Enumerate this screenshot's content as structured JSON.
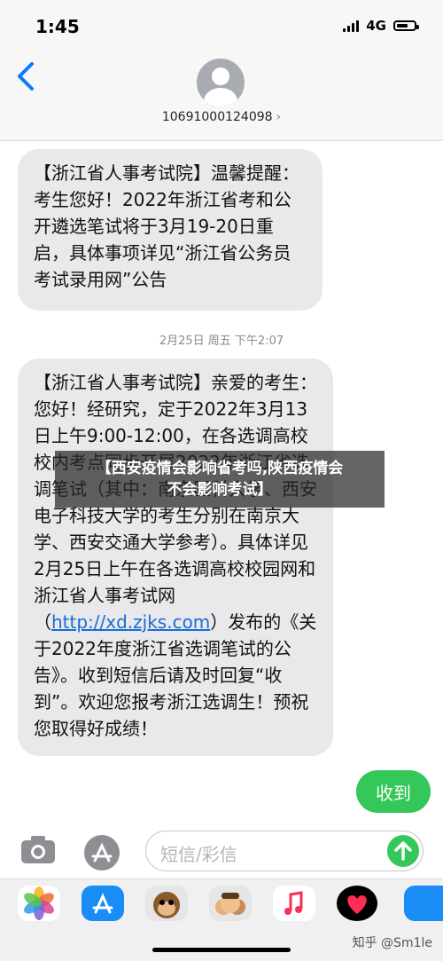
{
  "status_bar": {
    "time": "1:45",
    "network": "4G"
  },
  "header": {
    "sender": "10691000124098",
    "chevron": "›"
  },
  "messages": {
    "msg1": "【浙江省人事考试院】温馨提醒：考生您好！2022年浙江省考和公开遴选笔试将于3月19-20日重启，具体事项详见“浙江省公务员考试录用网”公告",
    "timestamp": "2月25日 周五 下午2:07",
    "msg2_part1": "【浙江省人事考试院】亲爱的考生：您好！经研究，定于2022年3月13日上午9:00-12:00，在各选调高校校内考点同步开展2022年浙江省选调笔试（其中：南京医科大学、西安电子科技大学的考生分别在南京大学、西安交通大学参考）。具体详见2月25日上午在各选调高校校园网和浙江省人事考试网（",
    "msg2_link": "http://xd.zjks.com",
    "msg2_part2": "）发布的《关于2022年度浙江省选调笔试的公告》。收到短信后请及时回复“收到”。欢迎您报考浙江选调生！预祝您取得好成绩！",
    "sent": "收到"
  },
  "banner": {
    "line1": "【西安疫情会影响省考吗,陕西疫情会",
    "line2": "不会影响考试】"
  },
  "input": {
    "placeholder": "短信/彩信"
  },
  "watermark": "知乎 @Sm1le",
  "colors": {
    "green": "#34c759",
    "bubble": "#e9e9eb",
    "link": "#1a6dd6",
    "ios_blue": "#0a7aff"
  }
}
